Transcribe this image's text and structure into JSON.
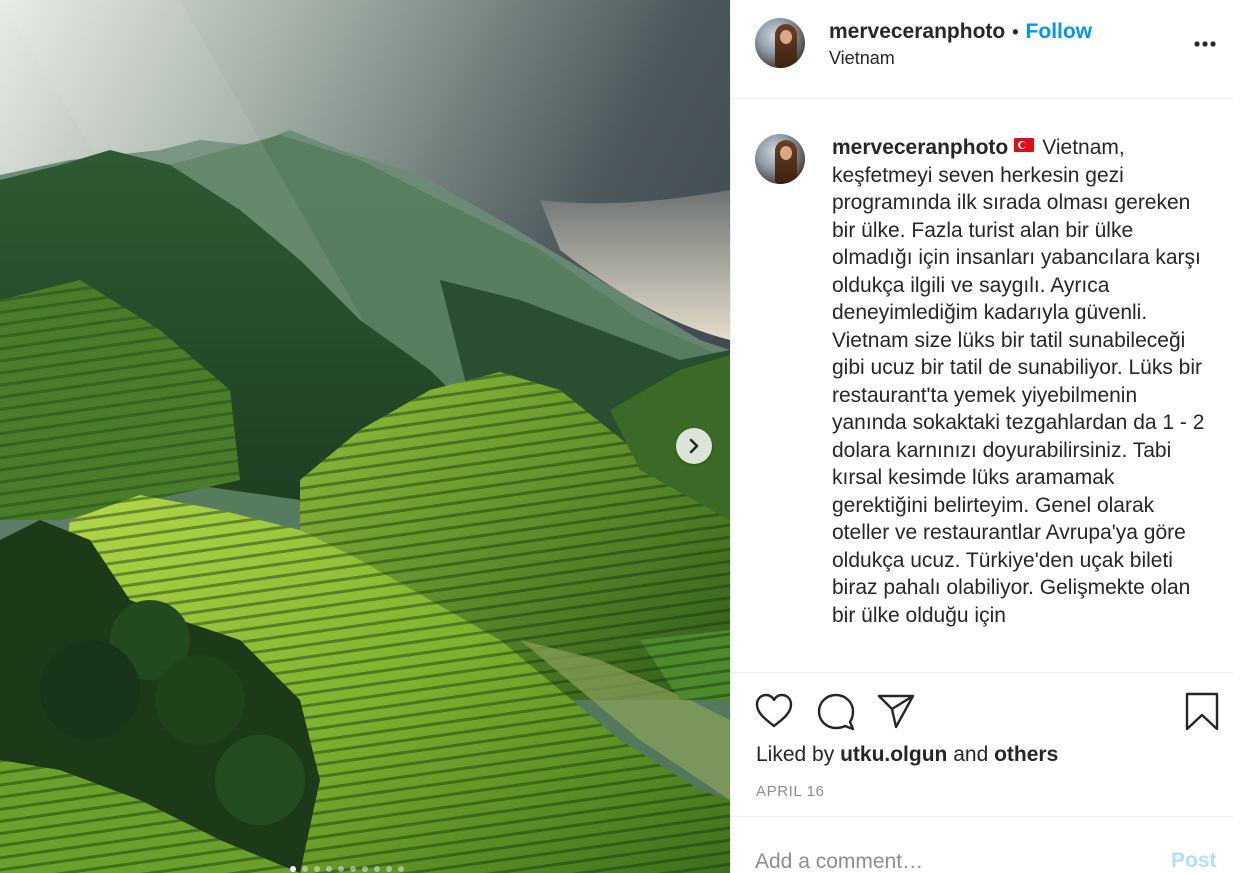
{
  "post": {
    "username": "merveceranphoto",
    "separator": "•",
    "follow_label": "Follow",
    "location": "Vietnam",
    "caption_text": "Vietnam, keşfetmeyi seven herkesin gezi programında ilk sırada olması gereken bir ülke. Fazla turist alan bir ülke olmadığı için insanları yabancılara karşı oldukça ilgili ve saygılı. Ayrıca deneyimlediğim kadarıyla güvenli. Vietnam size lüks bir tatil sunabileceği gibi ucuz bir tatil de sunabiliyor. Lüks bir restaurant'ta yemek yiyebilmenin yanında sokaktaki tezgahlardan da 1 - 2 dolara karnınızı doyurabilirsiniz. Tabi kırsal kesimde lüks aramamak gerektiğini belirteyim. Genel olarak oteller ve restaurantlar Avrupa'ya göre oldukça ucuz. Türkiye'den uçak bileti biraz pahalı olabiliyor. Gelişmekte olan bir ülke olduğu için",
    "flag_icon": "turkey-flag-icon"
  },
  "likes": {
    "prefix": "Liked by",
    "user": "utku.olgun",
    "conjunction": "and",
    "others": "others"
  },
  "date": "APRIL 16",
  "comment": {
    "placeholder": "Add a comment…",
    "post_label": "Post"
  },
  "carousel": {
    "slide_count": 10,
    "active_index": 0
  },
  "colors": {
    "accent": "#0095f6",
    "post_disabled": "#b2dffc",
    "muted": "#8e8e8e"
  }
}
